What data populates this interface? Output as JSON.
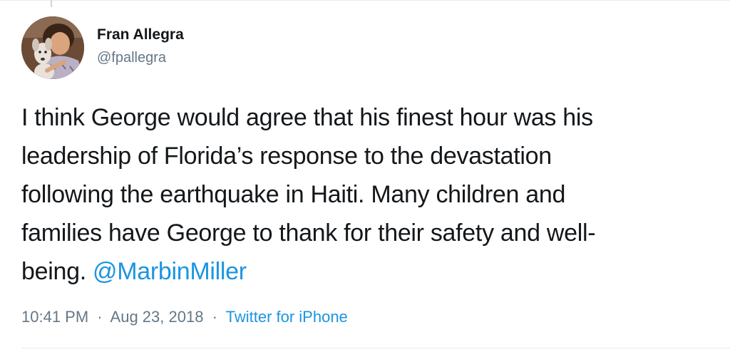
{
  "author": {
    "display_name": "Fran Allegra",
    "handle": "@fpallegra",
    "avatar_icon": "profile-photo-child-with-dog"
  },
  "tweet": {
    "lines": [
      "I think George would agree that his finest hour was his",
      "leadership of Florida’s response to the devastation",
      "following the earthquake in Haiti. Many children and",
      "families have George to thank for their safety and well-",
      "being. "
    ],
    "mention": "@MarbinMiller"
  },
  "meta": {
    "time": "10:41 PM",
    "date": "Aug 23, 2018",
    "separator": "·",
    "source": "Twitter for iPhone"
  },
  "colors": {
    "link": "#1b95e0",
    "text": "#14171a",
    "secondary": "#657786",
    "divider": "#e6ecf0"
  }
}
